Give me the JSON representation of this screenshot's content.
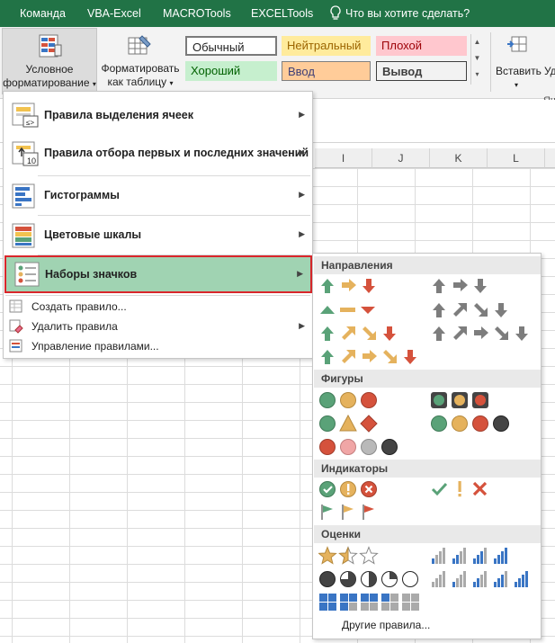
{
  "tabs": [
    "Команда",
    "VBA-Excel",
    "MACROTools",
    "EXCELTools"
  ],
  "tell_me": "Что вы хотите сделать?",
  "ribbon": {
    "cond_format": [
      "Условное",
      "форматирование"
    ],
    "format_table": [
      "Форматировать",
      "как таблицу"
    ],
    "styles": [
      "Обычный",
      "Нейтральный",
      "Плохой",
      "Хороший",
      "Ввод",
      "Вывод"
    ],
    "insert": "Вставить",
    "delete_partial": "Уд",
    "cells_group_partial": "Яч"
  },
  "columns": [
    "I",
    "J",
    "K",
    "L"
  ],
  "menu": {
    "items": [
      "Правила выделения ячеек",
      "Правила отбора первых и последних значений",
      "Гистограммы",
      "Цветовые шкалы",
      "Наборы значков"
    ],
    "small_items": [
      "Создать правило...",
      "Удалить правила",
      "Управление правилами..."
    ],
    "icon_badge": "10"
  },
  "submenu": {
    "sections": [
      "Направления",
      "Фигуры",
      "Индикаторы",
      "Оценки"
    ],
    "more_rules": "Другие правила..."
  },
  "colors": {
    "tab_bar": "#217346",
    "highlight": "#a0d3b2",
    "highlight_border": "#d9262b",
    "icon_green": "#5aa278",
    "icon_yellow": "#e5b25d",
    "icon_red": "#d5523c",
    "icon_gray": "#7d7d7d",
    "icon_blue": "#3a75c4"
  }
}
